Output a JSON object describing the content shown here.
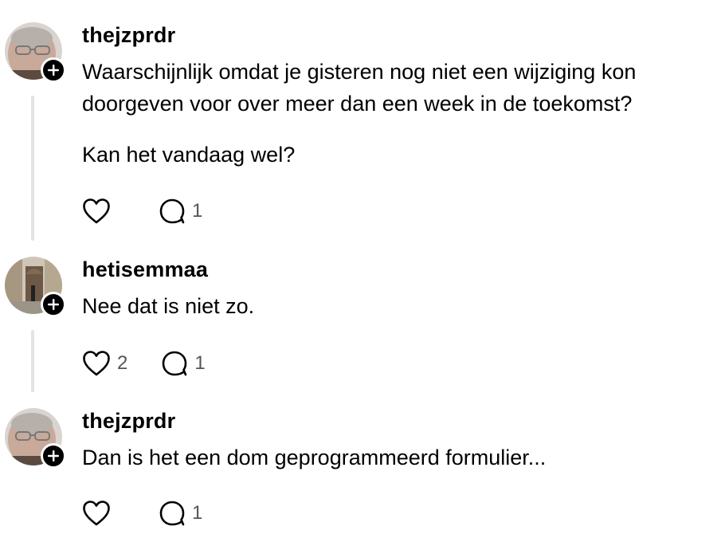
{
  "posts": [
    {
      "username": "thejzprdr",
      "paragraphs": [
        "Waarschijnlijk omdat je gisteren nog niet een wijziging kon doorgeven voor over meer dan een week in de toekomst?",
        "Kan het vandaag wel?"
      ],
      "likes": "",
      "replies": "1",
      "avatar_icon": "avatar-man-glasses"
    },
    {
      "username": "hetisemmaa",
      "paragraphs": [
        "Nee dat is niet zo."
      ],
      "likes": "2",
      "replies": "1",
      "avatar_icon": "avatar-street-photo"
    },
    {
      "username": "thejzprdr",
      "paragraphs": [
        "Dan is het een dom geprogrammeerd formulier..."
      ],
      "likes": "",
      "replies": "1",
      "avatar_icon": "avatar-man-glasses"
    }
  ],
  "icons": {
    "like": "heart-icon",
    "reply": "comment-icon",
    "follow": "plus-icon"
  },
  "colors": {
    "badge": "#000000",
    "thread_line": "#e3e3e3",
    "count_text": "#555555"
  }
}
